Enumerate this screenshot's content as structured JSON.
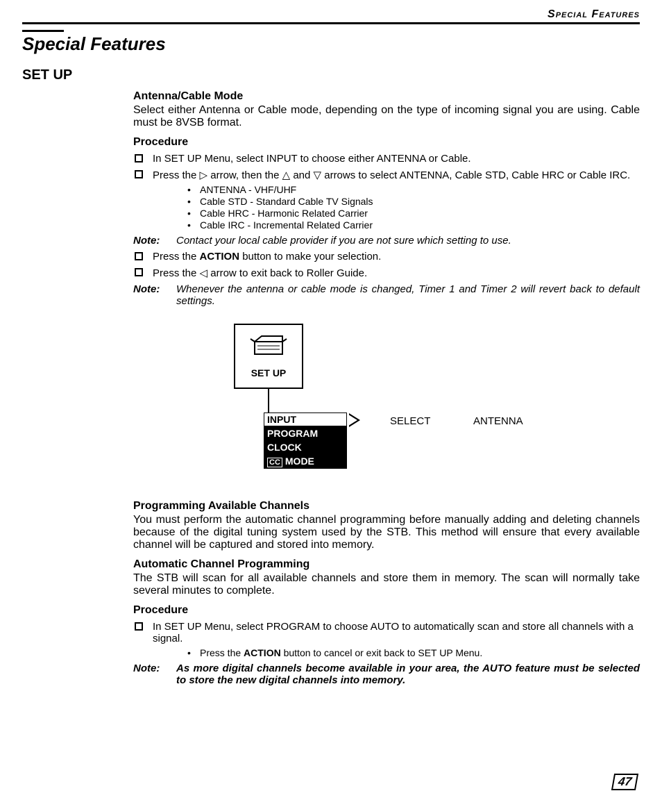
{
  "header": {
    "running": "Special Features"
  },
  "title": "Special Features",
  "h2": "SET UP",
  "section1": {
    "heading": "Antenna/Cable Mode",
    "intro": "Select either Antenna or Cable mode, depending on the type of incoming signal you are using.  Cable must be 8VSB format.",
    "procedure_label": "Procedure",
    "steps": [
      "In SET UP Menu, select INPUT to choose either ANTENNA or Cable.",
      "Press the ▷ arrow, then the △ and ▽ arrows to select ANTENNA, Cable STD, Cable HRC or Cable IRC."
    ],
    "sub_bullets": [
      "ANTENNA - VHF/UHF",
      "Cable STD - Standard Cable TV Signals",
      "Cable HRC - Harmonic Related Carrier",
      "Cable IRC - Incremental Related Carrier"
    ],
    "note1_label": "Note:",
    "note1_text": "Contact your local cable provider if you are not sure which setting to use.",
    "step3_pre": "Press the ",
    "step3_bold": "ACTION",
    "step3_post": " button to make your selection.",
    "step4": "Press the ◁ arrow to exit back to Roller Guide.",
    "note2_label": "Note:",
    "note2_text": "Whenever the antenna or cable mode is changed, Timer 1 and Timer 2 will revert back to default settings."
  },
  "figure": {
    "box_label": "SET UP",
    "menu": {
      "items": [
        "INPUT",
        "PROGRAM",
        "CLOCK"
      ],
      "cc_label": "CC",
      "cc_text": "MODE"
    },
    "select_label": "SELECT",
    "select_value": "ANTENNA"
  },
  "section2": {
    "heading": "Programming Available Channels",
    "para": "You must perform the automatic channel programming before manually adding and deleting channels because of the digital tuning system used by the STB.  This method will ensure that every available channel will be captured and stored into memory."
  },
  "section3": {
    "heading": "Automatic Channel Programming",
    "para": "The STB will scan for all available channels and store them in memory.  The scan will normally take several minutes to complete.",
    "procedure_label": "Procedure",
    "step1": "In SET UP Menu, select PROGRAM to choose AUTO to automatically scan and store all channels with a signal.",
    "sub_pre": "Press the ",
    "sub_bold": "ACTION",
    "sub_post": " button to cancel or exit back to SET UP Menu.",
    "note_label": "Note:",
    "note_text": "As more digital channels become available in your area, the AUTO feature must be selected to store the new digital channels into memory."
  },
  "page_number": "47"
}
